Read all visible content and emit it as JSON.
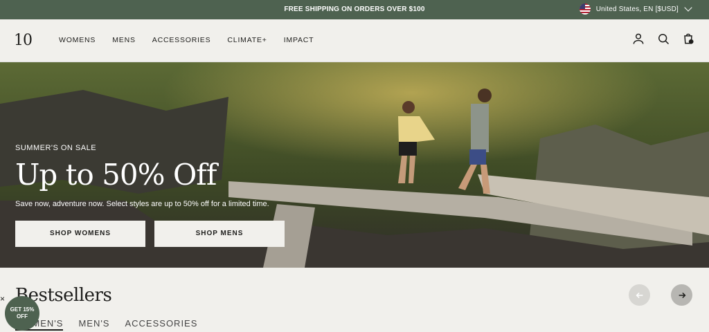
{
  "topbar": {
    "message": "FREE SHIPPING ON ORDERS OVER $100",
    "locale": "United States, EN [$USD]"
  },
  "header": {
    "logo": "10",
    "nav": [
      "WOMENS",
      "MENS",
      "ACCESSORIES",
      "CLIMATE+",
      "IMPACT"
    ],
    "cart_count": "0"
  },
  "hero": {
    "kicker": "SUMMER'S ON SALE",
    "title": "Up to 50% Off",
    "subtitle": "Save now, adventure now. Select styles are up to 50% off for a limited time.",
    "btn_womens": "SHOP WOMENS",
    "btn_mens": "SHOP MENS"
  },
  "bestsellers": {
    "title": "Bestsellers",
    "tabs": [
      "WOMEN'S",
      "MEN'S",
      "ACCESSORIES"
    ]
  },
  "promo": {
    "text": "GET 15% OFF",
    "close": "×"
  },
  "colors": {
    "brand": "#4e6250",
    "bg": "#f1f0ec",
    "text": "#1d1d1b"
  }
}
